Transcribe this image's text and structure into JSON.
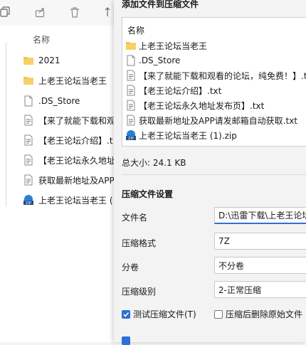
{
  "colors": {
    "accent": "#2f6fd6",
    "folder": "#f5c34a"
  },
  "explorer": {
    "toolbar": [
      {
        "icon": "copy-icon"
      },
      {
        "icon": "share-icon"
      },
      {
        "icon": "delete-icon"
      },
      {
        "icon": "sort-icon"
      }
    ],
    "column_header": "名称",
    "items": [
      {
        "name": "2021",
        "icon": "folder-icon"
      },
      {
        "name": "上老王论坛当老王",
        "icon": "folder-icon"
      },
      {
        "name": ".DS_Store",
        "icon": "file-icon"
      },
      {
        "name": "【来了就能下载和观",
        "icon": "text-file-icon"
      },
      {
        "name": "【老王论坛介绍】.t",
        "icon": "text-file-icon"
      },
      {
        "name": "【老王论坛永久地址",
        "icon": "text-file-icon"
      },
      {
        "name": "获取最新地址及APP",
        "icon": "text-file-icon"
      },
      {
        "name": "上老王论坛当老王 (",
        "icon": "zip-icon"
      }
    ]
  },
  "dialog": {
    "title": "添加文件到压缩文件",
    "list_header": "名称",
    "files": [
      {
        "name": "上老王论坛当老王",
        "icon": "folder-icon"
      },
      {
        "name": ".DS_Store",
        "icon": "file-icon"
      },
      {
        "name": "【来了就能下载和观看的论坛，纯免费！】.t",
        "icon": "text-file-icon"
      },
      {
        "name": "【老王论坛介绍】.txt",
        "icon": "text-file-icon"
      },
      {
        "name": "【老王论坛永久地址发布页】.txt",
        "icon": "text-file-icon"
      },
      {
        "name": "获取最新地址及APP请发邮箱自动获取.txt",
        "icon": "text-file-icon"
      },
      {
        "name": "上老王论坛当老王 (1).zip",
        "icon": "zip-icon"
      }
    ],
    "total_size": "总大小: 24.1 KB",
    "settings_title": "压缩文件设置",
    "fields": {
      "filename_label": "文件名",
      "filename_value": "D:\\迅雷下载\\上老王论坛",
      "format_label": "压缩格式",
      "format_value": "7Z",
      "split_label": "分卷",
      "split_value": "不分卷",
      "level_label": "压缩级别",
      "level_value": "2-正常压缩"
    },
    "options": {
      "test_label": "测试压缩文件(T)",
      "test_checked": true,
      "delete_label": "压缩后删除原始文件",
      "delete_checked": false
    }
  }
}
